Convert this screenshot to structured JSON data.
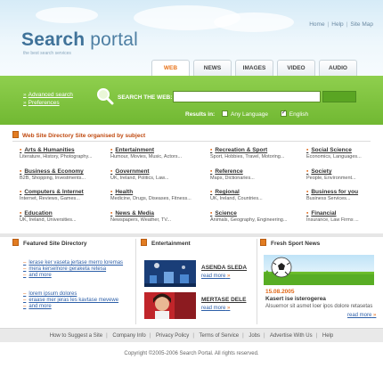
{
  "header": {
    "logo_word1": "Search",
    "logo_word2": " portal",
    "tagline": "the best search services",
    "links": [
      "Home",
      "Help",
      "Site Map"
    ]
  },
  "tabs": [
    "WEB",
    "NEWS",
    "IMAGES",
    "VIDEO",
    "AUDIO"
  ],
  "search": {
    "advanced_link": "Advanced search",
    "preferences_link": "Preferences",
    "label": "SEARCH THE WEB:",
    "query": "",
    "results_label": "Results in:",
    "options": [
      "Any Language",
      "English"
    ],
    "selected_option": "English"
  },
  "directory": {
    "title": "Web Site Directory Site organised by subject",
    "categories": [
      {
        "name": "Arts & Humanities",
        "sub": "Literature, History, Photography..."
      },
      {
        "name": "Entertainment",
        "sub": "Humour, Movies, Music, Actors..."
      },
      {
        "name": "Recreation & Sport",
        "sub": "Sport, Hobbies, Travel, Motoring..."
      },
      {
        "name": "Social Science",
        "sub": "Economics, Languages..."
      },
      {
        "name": "Business & Economy",
        "sub": "B2B, Shopping, Investments..."
      },
      {
        "name": "Government",
        "sub": "UK, Ireland, Politics, Law..."
      },
      {
        "name": "Reference",
        "sub": "Maps, Dictionaries..."
      },
      {
        "name": "Society",
        "sub": "People, Environment..."
      },
      {
        "name": "Computers & Internet",
        "sub": "Internet, Reviews, Games..."
      },
      {
        "name": "Health",
        "sub": "Medicine, Drugs, Diseases, Fitness..."
      },
      {
        "name": "Regional",
        "sub": "UK, Ireland, Countries..."
      },
      {
        "name": "Business for you",
        "sub": "Business Services..."
      },
      {
        "name": "Education",
        "sub": "UK, Ireland, Universities..."
      },
      {
        "name": "News & Media",
        "sub": "Newspapers, Weather, TV..."
      },
      {
        "name": "Science",
        "sub": "Animals, Geography, Engineering..."
      },
      {
        "name": "Financial",
        "sub": "Insurance, Law Firms ..."
      }
    ]
  },
  "featured": {
    "title": "Featured Site Directory",
    "links": [
      "lerase ker vaseta jertase merro loremas",
      "mera kerselnore geraketa retesa",
      "and more",
      "lorem ipsum dolores",
      "eraase mer jeras les kavtase mevewe",
      "and more"
    ]
  },
  "entertainment": {
    "title": "Entertainment",
    "items": [
      {
        "title": "ASENDA SLEDA",
        "more": "read more"
      },
      {
        "title": "MERTASE DELE",
        "more": "read more"
      }
    ]
  },
  "sport": {
    "title": "Fresh Sport News",
    "date": "15.08.2005",
    "headline": "Kasert ise isterogerea",
    "text": "Alsuernor sit asmet loer ipos dolore retasetas",
    "more": "read more"
  },
  "footer": {
    "links": [
      "How to Suggest a Site",
      "Company Info",
      "Privacy Policy",
      "Terms of Service",
      "Jobs",
      "Advertise With Us",
      "Help"
    ],
    "copyright": "Copyright ©2005-2006 Search Portal. All rights reserved."
  },
  "colors": {
    "accent_orange": "#e06818",
    "search_green": "#7cc23d",
    "logo_blue": "#4e7fa3",
    "link_blue": "#2d5fa8"
  }
}
